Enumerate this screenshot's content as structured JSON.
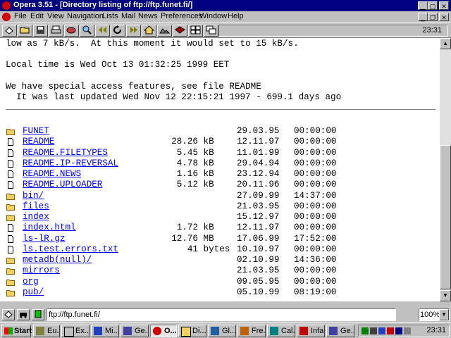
{
  "window": {
    "title": "Opera 3.51 - [Directory listing of ftp://ftp.funet.fi/]"
  },
  "menu": {
    "items": [
      "File",
      "Edit",
      "View",
      "Navigation",
      "Lists",
      "Mail",
      "News",
      "Preferences",
      "Window",
      "Help"
    ]
  },
  "toolbar": {
    "icons": [
      "open-window-icon",
      "open-folder-icon",
      "save-icon",
      "print-icon",
      "hotlist-icon",
      "find-icon",
      "back-icon",
      "reload-icon",
      "forward-icon",
      "home-icon",
      "images-icon",
      "mail-icon",
      "tile-icon",
      "cascade-icon"
    ],
    "clock": "23:31"
  },
  "page": {
    "lines": [
      "low as 7 kB/s.  At this moment it would set to 15 kB/s.",
      "Local time is Wed Oct 13 01:32:25 1999 EET",
      "We have special access features, see file README",
      "  It was last updated Wed Nov 12 22:15:21 1997 - 699.1 days ago"
    ],
    "listing": [
      {
        "name": "FUNET",
        "type": "folder",
        "size": "",
        "date": "29.03.95",
        "time": "00:00:00"
      },
      {
        "name": "README",
        "type": "file",
        "size": "28.26 kB",
        "date": "12.11.97",
        "time": "00:00:00"
      },
      {
        "name": "README.FILETYPES",
        "type": "file",
        "size": "5.45 kB",
        "date": "11.01.99",
        "time": "00:00:00"
      },
      {
        "name": "README.IP-REVERSAL",
        "type": "file",
        "size": "4.78 kB",
        "date": "29.04.94",
        "time": "00:00:00"
      },
      {
        "name": "README.NEWS",
        "type": "file",
        "size": "1.16 kB",
        "date": "23.12.94",
        "time": "00:00:00"
      },
      {
        "name": "README.UPLOADER",
        "type": "file",
        "size": "5.12 kB",
        "date": "20.11.96",
        "time": "00:00:00"
      },
      {
        "name": "bin/",
        "type": "folder",
        "size": "",
        "date": "27.09.99",
        "time": "14:37:00"
      },
      {
        "name": "files",
        "type": "folder",
        "size": "",
        "date": "21.03.95",
        "time": "00:00:00"
      },
      {
        "name": "index",
        "type": "folder",
        "size": "",
        "date": "15.12.97",
        "time": "00:00:00"
      },
      {
        "name": "index.html",
        "type": "file",
        "size": "1.72 kB",
        "date": "12.11.97",
        "time": "00:00:00"
      },
      {
        "name": "ls-lR.gz",
        "type": "file",
        "size": "12.76 MB",
        "date": "17.06.99",
        "time": "17:52:00"
      },
      {
        "name": "ls.test.errors.txt",
        "type": "file",
        "size": "41 bytes",
        "date": "10.10.97",
        "time": "00:00:00"
      },
      {
        "name": "metadb(null)/",
        "type": "folder",
        "size": "",
        "date": "02.10.99",
        "time": "14:36:00"
      },
      {
        "name": "mirrors",
        "type": "folder",
        "size": "",
        "date": "21.03.95",
        "time": "00:00:00"
      },
      {
        "name": "org",
        "type": "folder",
        "size": "",
        "date": "09.05.95",
        "time": "00:00:00"
      },
      {
        "name": "pub/",
        "type": "folder",
        "size": "",
        "date": "05.10.99",
        "time": "08:19:00"
      }
    ]
  },
  "address": {
    "url": "ftp://ftp.funet.fi/",
    "zoom": "100%"
  },
  "taskbar": {
    "start": "Start",
    "tasks": [
      "Eu...",
      "Ex...",
      "Mi...",
      "Ge...",
      "O...",
      "Di...",
      "Gl...",
      "Fre...",
      "Cal...",
      "Infa...",
      "Ge..."
    ],
    "clock": "23:31"
  },
  "colors": {
    "titlebar": "#000080",
    "link": "#0000ff",
    "folder": "#f0d060"
  }
}
